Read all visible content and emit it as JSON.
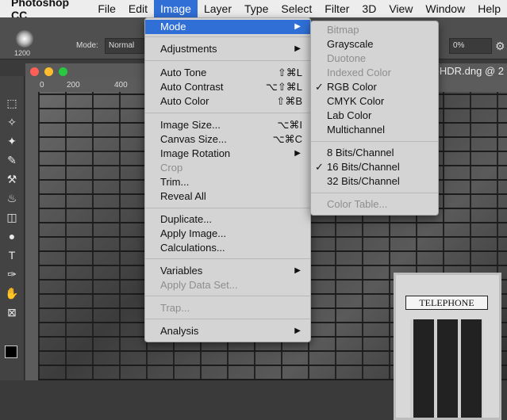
{
  "menubar": {
    "app": "Photoshop CC",
    "items": [
      "File",
      "Edit",
      "Image",
      "Layer",
      "Type",
      "Select",
      "Filter",
      "3D",
      "View",
      "Window",
      "Help"
    ]
  },
  "options": {
    "brush_size": "1200",
    "mode_label": "Mode:",
    "mode_value": "Normal",
    "opacity": "0%"
  },
  "document": {
    "title": "3-HDR.dng @ 2",
    "ruler_ticks": [
      "0",
      "200",
      "400"
    ],
    "sign_text": "TELEPHONE"
  },
  "image_menu": {
    "mode": "Mode",
    "adjustments": "Adjustments",
    "auto_tone": "Auto Tone",
    "auto_tone_sc": "⇧⌘L",
    "auto_contrast": "Auto Contrast",
    "auto_contrast_sc": "⌥⇧⌘L",
    "auto_color": "Auto Color",
    "auto_color_sc": "⇧⌘B",
    "image_size": "Image Size...",
    "image_size_sc": "⌥⌘I",
    "canvas_size": "Canvas Size...",
    "canvas_size_sc": "⌥⌘C",
    "image_rotation": "Image Rotation",
    "crop": "Crop",
    "trim": "Trim...",
    "reveal_all": "Reveal All",
    "duplicate": "Duplicate...",
    "apply_image": "Apply Image...",
    "calculations": "Calculations...",
    "variables": "Variables",
    "apply_data_set": "Apply Data Set...",
    "trap": "Trap...",
    "analysis": "Analysis"
  },
  "mode_menu": {
    "bitmap": "Bitmap",
    "grayscale": "Grayscale",
    "duotone": "Duotone",
    "indexed_color": "Indexed Color",
    "rgb_color": "RGB Color",
    "cmyk_color": "CMYK Color",
    "lab_color": "Lab Color",
    "multichannel": "Multichannel",
    "bits8": "8 Bits/Channel",
    "bits16": "16 Bits/Channel",
    "bits32": "32 Bits/Channel",
    "color_table": "Color Table..."
  }
}
